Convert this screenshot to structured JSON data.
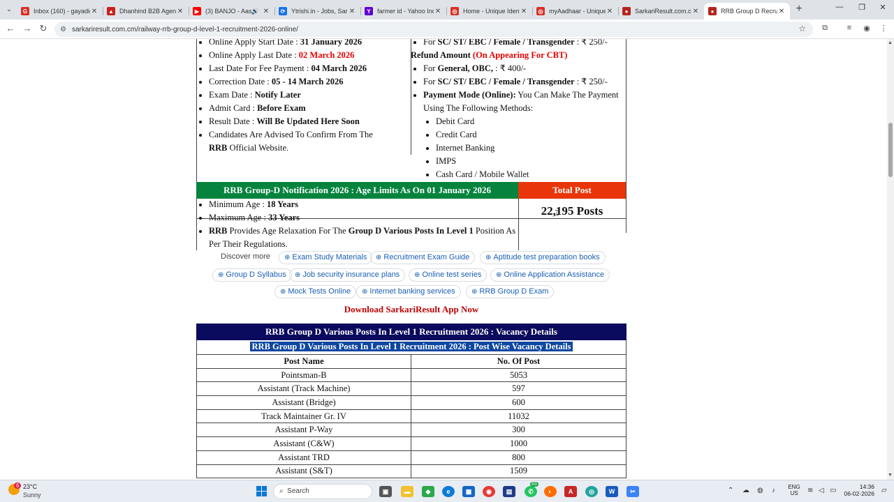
{
  "browser": {
    "tabs": [
      {
        "title": "Inbox (160) - gayadig",
        "favicon": "G",
        "color": "#d93025"
      },
      {
        "title": "Dhanhind B2B Agent",
        "favicon": "▲",
        "color": "#c5221f"
      },
      {
        "title": "(3) BANJO - Aash",
        "favicon": "▶",
        "color": "#ff0000"
      },
      {
        "title": "Ytrishi.in - Jobs, Sarka",
        "favicon": "⟳",
        "color": "#1a73e8"
      },
      {
        "title": "farmer id - Yahoo Indi",
        "favicon": "Y",
        "color": "#6001d2"
      },
      {
        "title": "Home - Unique Ident",
        "favicon": "◎",
        "color": "#d93025"
      },
      {
        "title": "myAadhaar - Unique",
        "favicon": "◎",
        "color": "#d93025"
      },
      {
        "title": "SarkariResult.com.cn",
        "favicon": "●",
        "color": "#b3261e"
      },
      {
        "title": "RRB Group D Recruit",
        "favicon": "●",
        "color": "#b3261e"
      }
    ],
    "url": "sarkariresult.com.cm/railway-rrb-group-d-level-1-recruitment-2026-online/"
  },
  "dates": [
    {
      "label": "Online Apply Start Date : ",
      "value": "31 January 2026",
      "red": false
    },
    {
      "label": "Online Apply Last Date : ",
      "value": "02 March 2026",
      "red": true
    },
    {
      "label": "Last Date For Fee Payment : ",
      "value": "04 March 2026",
      "red": false
    },
    {
      "label": "Correction Date : ",
      "value": "05 - 14 March 2026",
      "red": false
    },
    {
      "label": "Exam Date : ",
      "value": "Notify Later",
      "red": false
    },
    {
      "label": "Admit Card : ",
      "value": "Before Exam",
      "red": false
    },
    {
      "label": "Result Date : ",
      "value": "Will Be Updated Here Soon",
      "red": false
    }
  ],
  "advise": {
    "pre": "Candidates Are Advised To Confirm From The ",
    "bold": "RRB",
    "post": " Official Website."
  },
  "fees": {
    "sc_top": {
      "label": "For ",
      "cats": "SC/ ST/ EBC / Female / Transgender",
      "amt": " : ₹ 250/-"
    },
    "refund_label": "Refund Amount ",
    "refund_note": "(On Appearing For CBT)",
    "gen": {
      "label": "For ",
      "cats": "General, OBC,",
      "amt": " : ₹ 400/-"
    },
    "sc": {
      "label": "For ",
      "cats": "SC/ ST/ EBC / Female / Transgender",
      "amt": " : ₹ 250/-"
    },
    "payment_label": "Payment Mode (Online):",
    "payment_text": " You Can Make The Payment Using The Following Methods:",
    "methods": [
      "Debit Card",
      "Credit Card",
      "Internet Banking",
      "IMPS",
      "Cash Card / Mobile Wallet"
    ]
  },
  "age": {
    "header": "RRB Group-D Notification 2026 : Age Limits As On 01 January 2026",
    "min_label": "Minimum Age : ",
    "min": "18 Years",
    "max_label": "Maximum Age : ",
    "max": "33 Years",
    "relax_b1": "RRB",
    "relax_t1": " Provides Age Relaxation For The ",
    "relax_b2": "Group D Various Posts In Level 1",
    "relax_t2": " Position As Per Their Regulations."
  },
  "total": {
    "header": "Total Post",
    "value": "22,195 Posts"
  },
  "discover": {
    "label": "Discover more",
    "chips": [
      "Exam Study Materials",
      "Recruitment Exam Guide",
      "Aptitude test preparation books",
      "Group D Syllabus",
      "Job security insurance plans",
      "Online test series",
      "Online Application Assistance",
      "Mock Tests Online",
      "Internet banking services",
      "RRB Group D Exam"
    ]
  },
  "download": "Download SarkariResult App Now",
  "vacancy": {
    "title": "RRB Group D Various Posts In Level 1 Recruitment 2026 : Vacancy Details",
    "subtitle": "RRB Group D Various Posts In Level 1 Recruitment 2026 : Post Wise Vacancy Details",
    "col1": "Post Name",
    "col2": "No. Of Post",
    "rows": [
      [
        "Pointsman-B",
        "5053"
      ],
      [
        "Assistant (Track Machine)",
        "597"
      ],
      [
        "Assistant (Bridge)",
        "600"
      ],
      [
        "Track Maintainer Gr. IV",
        "11032"
      ],
      [
        "Assistant P-Way",
        "300"
      ],
      [
        "Assistant (C&W)",
        "1000"
      ],
      [
        "Assistant TRD",
        "800"
      ],
      [
        "Assistant (S&T)",
        "1509"
      ]
    ]
  },
  "taskbar": {
    "weather_temp": "23°C",
    "weather_text": "Sunny",
    "search": "Search",
    "lang1": "ENG",
    "lang2": "US",
    "time": "14:36",
    "date": "06-02-2026",
    "badge": "6",
    "whatsapp_badge": "83"
  }
}
